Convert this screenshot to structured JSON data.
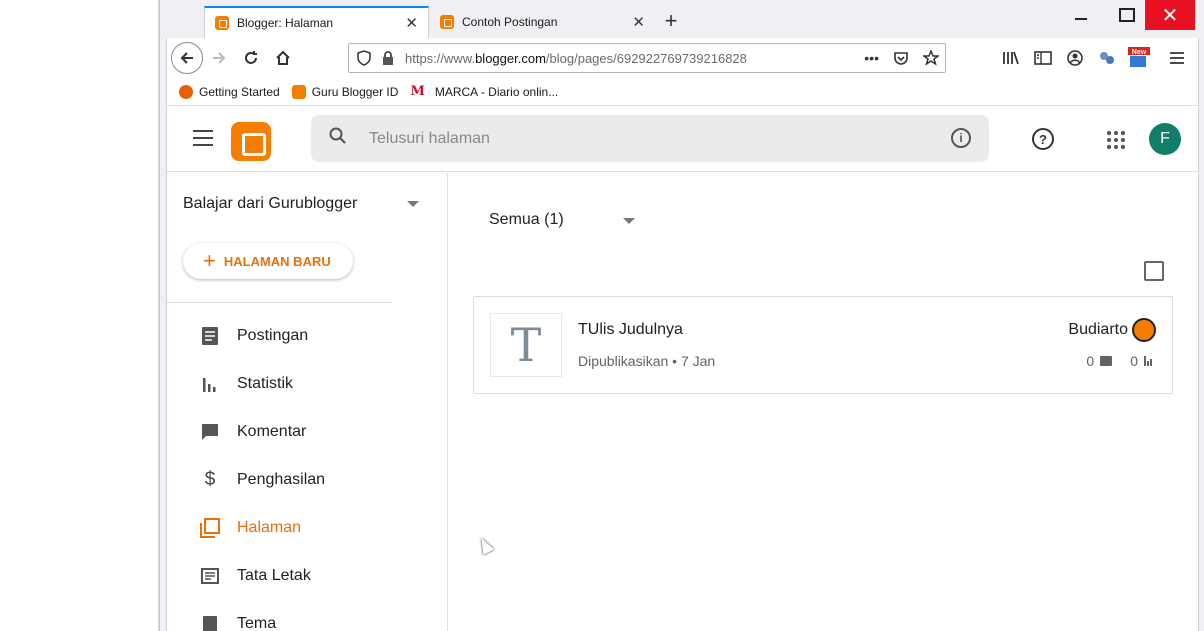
{
  "browser": {
    "tabs": [
      {
        "label": "Blogger: Halaman"
      },
      {
        "label": "Contoh Postingan"
      }
    ],
    "url_prefix": "https://www.",
    "url_domain": "blogger.com",
    "url_path": "/blog/pages/692922769739216828",
    "bookmarks": [
      {
        "label": "Getting Started"
      },
      {
        "label": "Guru Blogger ID"
      },
      {
        "label": "MARCA - Diario onlin..."
      }
    ],
    "new_badge": "New"
  },
  "header": {
    "search_placeholder": "Telusuri halaman",
    "avatar_letter": "F"
  },
  "sidebar": {
    "blog_name": "Balajar dari Gurublogger",
    "new_page_label": "HALAMAN BARU",
    "items": [
      {
        "label": "Postingan",
        "icon": "posts-icon"
      },
      {
        "label": "Statistik",
        "icon": "stats-icon"
      },
      {
        "label": "Komentar",
        "icon": "comment-icon"
      },
      {
        "label": "Penghasilan",
        "icon": "dollar-icon"
      },
      {
        "label": "Halaman",
        "icon": "pages-icon",
        "active": true
      },
      {
        "label": "Tata Letak",
        "icon": "layout-icon"
      },
      {
        "label": "Tema",
        "icon": "theme-icon"
      }
    ]
  },
  "main": {
    "filter_label": "Semua (1)",
    "pages": [
      {
        "thumb_letter": "T",
        "title": "TUlis Judulnya",
        "status": "Dipublikasikan • 7 Jan",
        "author": "Budiarto",
        "comments": "0",
        "views": "0"
      }
    ]
  },
  "colors": {
    "accent": "#e8710a",
    "blogger_orange": "#f57d00",
    "avatar": "#137d6b"
  }
}
